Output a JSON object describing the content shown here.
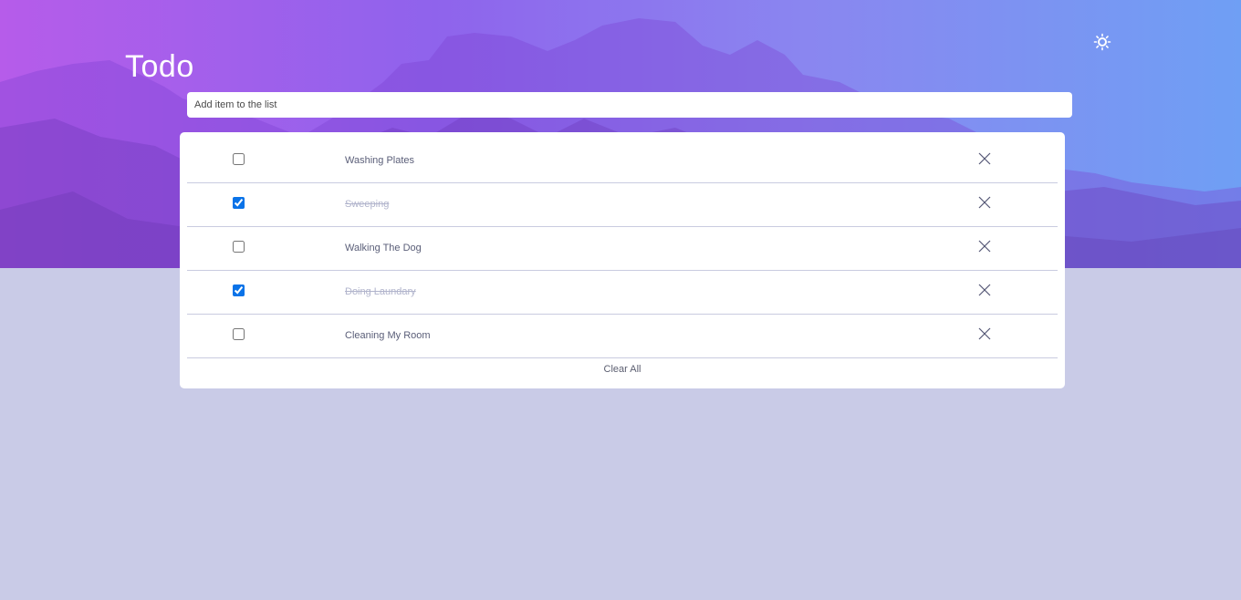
{
  "header": {
    "title": "Todo",
    "theme_icon": "sun-icon"
  },
  "new_item": {
    "placeholder": "Add item to the list",
    "value": ""
  },
  "todos": [
    {
      "label": "Washing Plates",
      "completed": false
    },
    {
      "label": "Sweeping",
      "completed": true
    },
    {
      "label": "Walking The Dog",
      "completed": false
    },
    {
      "label": "Doing Laundary",
      "completed": true
    },
    {
      "label": "Cleaning My Room",
      "completed": false
    }
  ],
  "footer": {
    "clear_label": "Clear All"
  },
  "colors": {
    "page_background": "#c9cbe7",
    "checkbox_accent": "#0a73e8",
    "completed_text": "#b1b4cc",
    "active_text": "#5a5e78"
  },
  "icons": {
    "delete": "close-icon"
  }
}
